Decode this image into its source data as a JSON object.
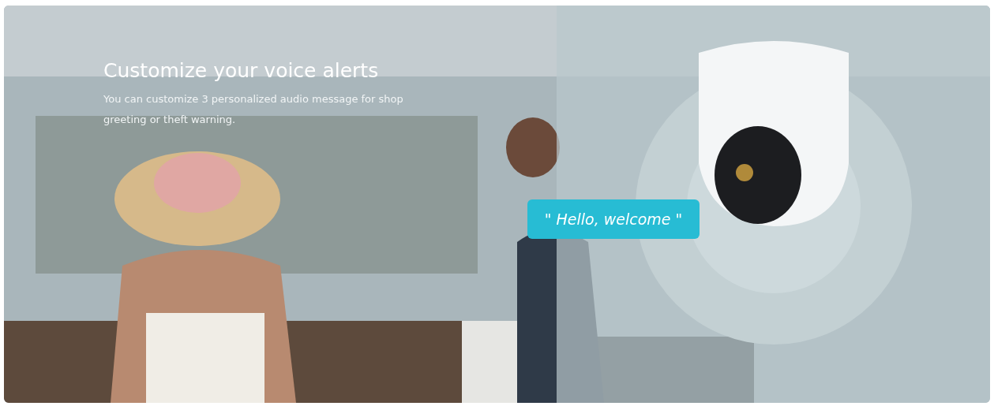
{
  "banner": {
    "kind": "picture",
    "heading": "Customize your voice alerts",
    "description": "You can customize 3 personalized audio message for shop greeting or theft warning.",
    "speech_bubble": "\" Hello, welcome \""
  }
}
